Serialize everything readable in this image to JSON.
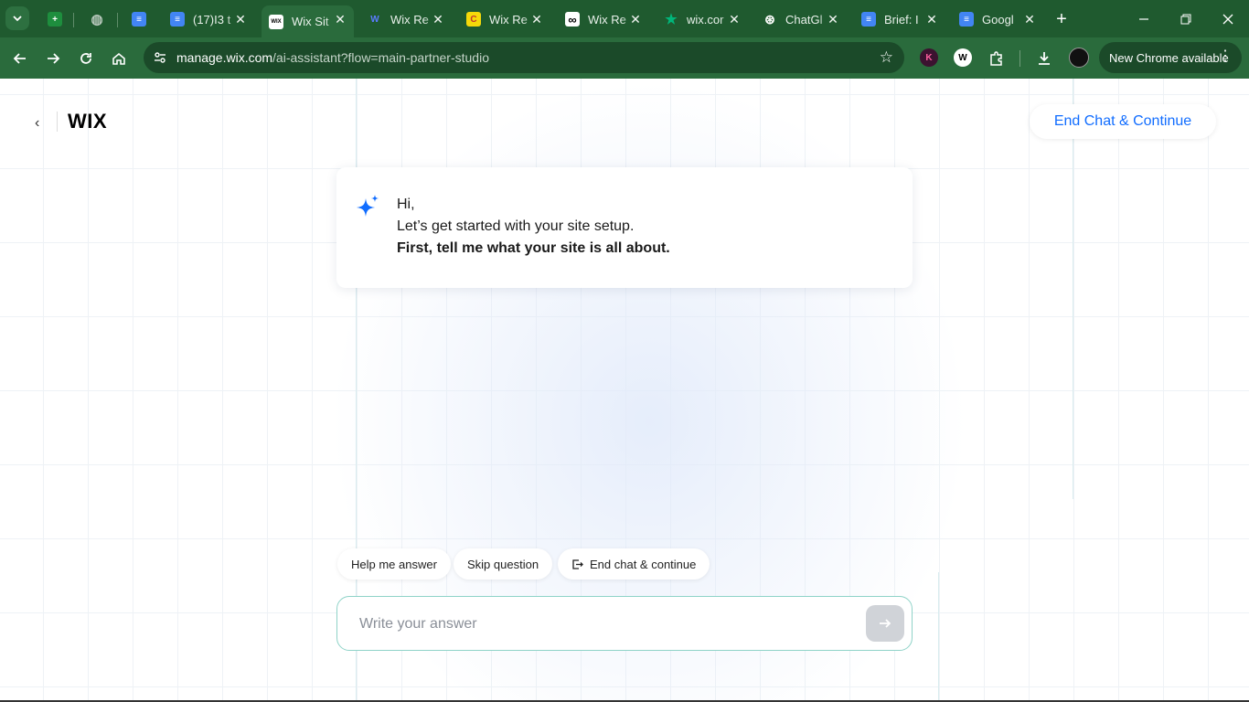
{
  "browser": {
    "tabs": [
      {
        "title": "",
        "fav_color": "#1e8e3e",
        "fav_text": "+"
      },
      {
        "title": "",
        "fav_color": "#6b7b70",
        "fav_text": "◍"
      },
      {
        "title": "",
        "fav_color": "#4285f4",
        "fav_text": "≡"
      },
      {
        "title": "(17)I3 t",
        "fav_color": "#4285f4",
        "fav_text": "≡"
      },
      {
        "title": "Wix Sit",
        "fav_color": "#ffffff",
        "fav_text": "WIX"
      },
      {
        "title": "Wix Re",
        "fav_color": "#3b5bff",
        "fav_text": "W"
      },
      {
        "title": "Wix Re",
        "fav_color": "#f5d90a",
        "fav_text": "C"
      },
      {
        "title": "Wix Re",
        "fav_color": "#ffffff",
        "fav_text": "∞"
      },
      {
        "title": "wix.cor",
        "fav_color": "#00b67a",
        "fav_text": "★"
      },
      {
        "title": "ChatGl",
        "fav_color": "#ffffff",
        "fav_text": "⊛"
      },
      {
        "title": "Brief: I",
        "fav_color": "#4285f4",
        "fav_text": "≡"
      },
      {
        "title": "Googl",
        "fav_color": "#4285f4",
        "fav_text": "≡"
      }
    ],
    "url_host": "manage.wix.com",
    "url_path": "/ai-assistant?flow=main-partner-studio",
    "update_label": "New Chrome available",
    "ext_k": "K",
    "ext_w": "W"
  },
  "page": {
    "logo": "WIX",
    "end_chat_top": "End Chat & Continue",
    "message": {
      "line1": "Hi,",
      "line2": "Let’s get started with your site setup.",
      "line3": "First, tell me what your site is all about."
    },
    "chips": {
      "help": "Help me answer",
      "skip": "Skip question",
      "end": "End chat & continue"
    },
    "answer_placeholder": "Write your answer",
    "accent_color": "#116dff"
  }
}
